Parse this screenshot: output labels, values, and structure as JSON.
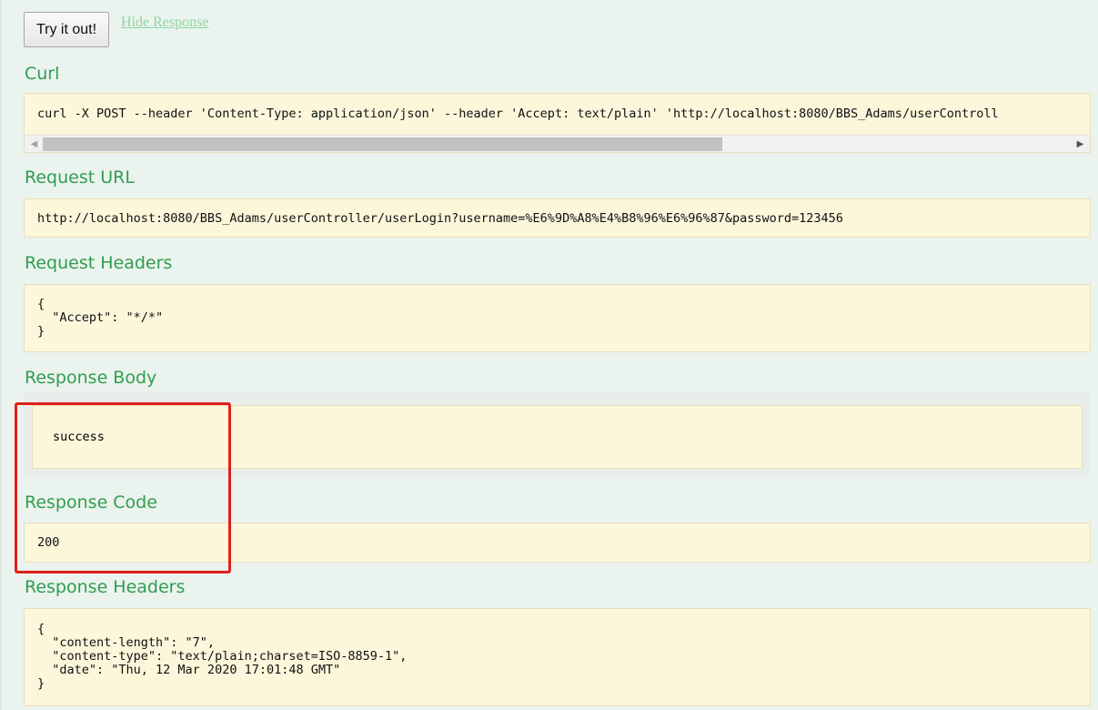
{
  "actions": {
    "try_label": "Try it out!",
    "hide_label": "Hide Response"
  },
  "curl": {
    "heading": "Curl",
    "command": "curl -X POST --header 'Content-Type: application/json' --header 'Accept: text/plain' 'http://localhost:8080/BBS_Adams/userControll"
  },
  "request_url": {
    "heading": "Request URL",
    "value": "http://localhost:8080/BBS_Adams/userController/userLogin?username=%E6%9D%A8%E4%B8%96%E6%96%87&password=123456"
  },
  "request_headers": {
    "heading": "Request Headers",
    "value": "{\n  \"Accept\": \"*/*\"\n}"
  },
  "response_body": {
    "heading": "Response Body",
    "value": "success"
  },
  "response_code": {
    "heading": "Response Code",
    "value": "200"
  },
  "response_headers": {
    "heading": "Response Headers",
    "value": "{\n  \"content-length\": \"7\",\n  \"content-type\": \"text/plain;charset=ISO-8859-1\",\n  \"date\": \"Thu, 12 Mar 2020 17:01:48 GMT\"\n}"
  },
  "colors": {
    "heading_green": "#2f9d4f",
    "code_background": "#fcf6db",
    "page_background": "#ebf3ee",
    "highlight_red": "#e0201a"
  },
  "icons": {
    "scroll_left": "triangle-left-icon",
    "scroll_right": "triangle-right-icon"
  }
}
